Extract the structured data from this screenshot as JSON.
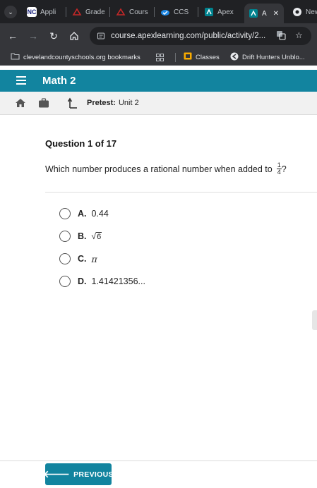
{
  "browser": {
    "tabs": [
      {
        "label": "Appli",
        "favicon": "NC",
        "color": "#ffffff",
        "text_color": "#1a237e"
      },
      {
        "label": "Grade",
        "favicon": "grade-icon",
        "color": "#c62828"
      },
      {
        "label": "Cours",
        "favicon": "course-icon",
        "color": "#c62828"
      },
      {
        "label": "CCS",
        "favicon": "cloud-icon",
        "color": "#1e88e5"
      },
      {
        "label": "Apex",
        "favicon": "apex-icon",
        "color": "#00838f"
      },
      {
        "label": "A",
        "favicon": "apex-icon",
        "color": "#00838f",
        "active": true
      },
      {
        "label": "New",
        "favicon": "chrome-icon",
        "color": "#ffffff"
      }
    ],
    "close_glyph": "✕",
    "url": "course.apexlearning.com/public/activity/2...",
    "bookmarks": [
      {
        "label": "clevelandcountyschools.org bookmarks",
        "icon": "folder-icon"
      },
      {
        "label": "Classes",
        "icon": "classes-icon"
      },
      {
        "label": "Drift Hunters Unblo...",
        "icon": "drift-icon"
      }
    ]
  },
  "app": {
    "title": "Math 2",
    "pretest_label": "Pretest:",
    "pretest_unit": "Unit 2"
  },
  "question": {
    "number": "Question 1 of 17",
    "text": "Which number produces a rational number when added to",
    "fraction_num": "1",
    "fraction_den": "4",
    "text_end": "?",
    "options": [
      {
        "letter": "A.",
        "value": "0.44"
      },
      {
        "letter": "B.",
        "value": "6"
      },
      {
        "letter": "C.",
        "value": "π"
      },
      {
        "letter": "D.",
        "value": "1.41421356..."
      }
    ]
  },
  "footer": {
    "previous_label": "PREVIOUS"
  },
  "colors": {
    "accent": "#12849f"
  }
}
